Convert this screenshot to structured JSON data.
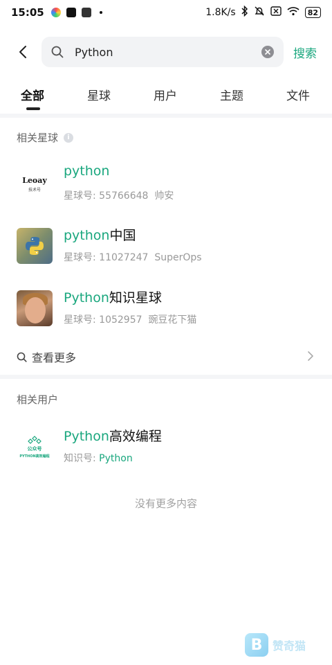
{
  "status_bar": {
    "time": "15:05",
    "network_speed": "1.8K/s",
    "battery": "82"
  },
  "search": {
    "query": "Python",
    "submit_label": "搜索"
  },
  "tabs": [
    {
      "label": "全部",
      "active": true
    },
    {
      "label": "星球"
    },
    {
      "label": "用户"
    },
    {
      "label": "主题"
    },
    {
      "label": "文件"
    }
  ],
  "sections": {
    "planets_title": "相关星球",
    "users_title": "相关用户"
  },
  "planets": [
    {
      "title_hl": "python",
      "title_rest": "",
      "id_label": "星球号:",
      "id": "55766648",
      "owner": "帅安",
      "avatar": "leoay-logo"
    },
    {
      "title_hl": "python",
      "title_rest": "中国",
      "id_label": "星球号:",
      "id": "11027247",
      "owner": "SuperOps",
      "avatar": "python-logo"
    },
    {
      "title_hl": "Python",
      "title_rest": "知识星球",
      "id_label": "星球号:",
      "id": "1052957",
      "owner": "豌豆花下猫",
      "avatar": "person-photo"
    }
  ],
  "avatar_text": {
    "leoay_line1": "Leoay",
    "leoay_line2": "技术号",
    "gzh_line1": "公众号",
    "gzh_line2": "PYTHON高效编程"
  },
  "more_label": "查看更多",
  "users": [
    {
      "title_hl": "Python",
      "title_rest": "高效编程",
      "id_label": "知识号:",
      "id_hl": "Python",
      "avatar": "wechat-official-logo"
    }
  ],
  "footer": "没有更多内容",
  "watermark": {
    "text": "赞奇猫",
    "icon": "B"
  },
  "colors": {
    "accent": "#1aa77e"
  }
}
